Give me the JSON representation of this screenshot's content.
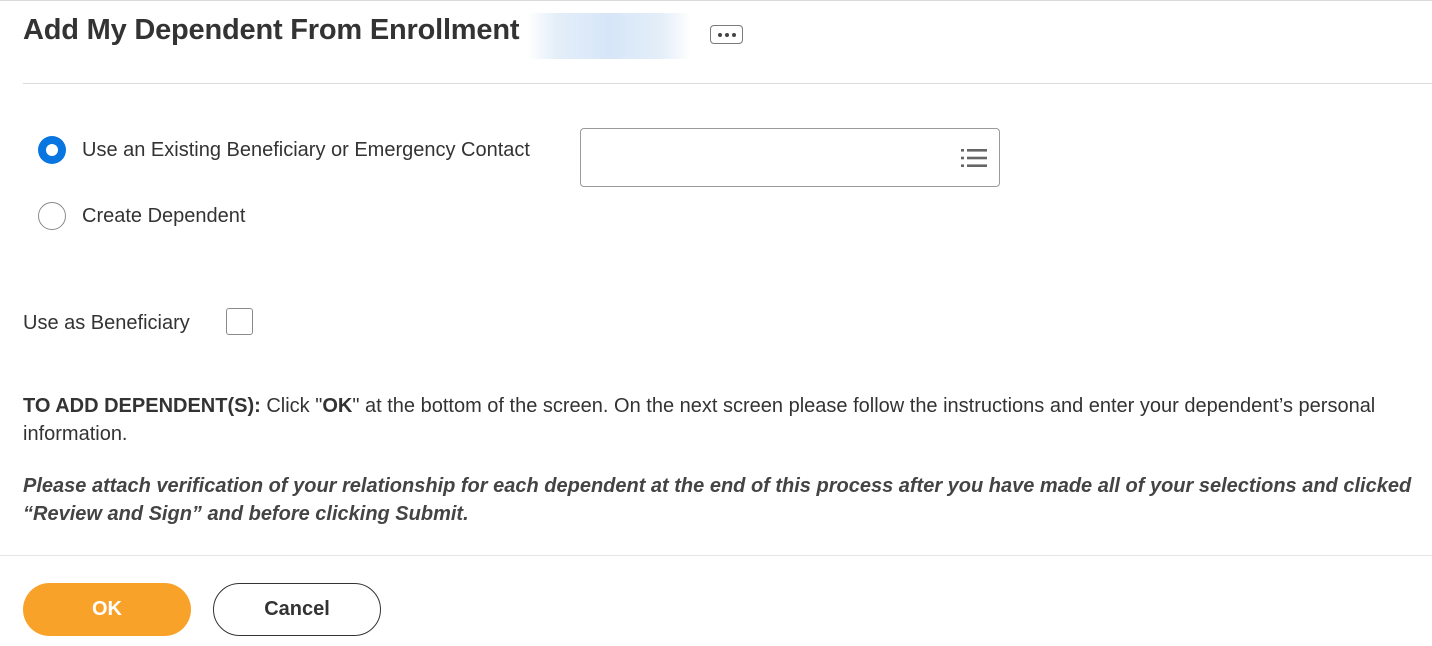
{
  "header": {
    "title": "Add My Dependent From Enrollment"
  },
  "options": {
    "existing_label": "Use an Existing Beneficiary or Emergency Contact",
    "create_label": "Create Dependent",
    "selected": "existing"
  },
  "prompt": {
    "value": "",
    "icon": "list-prompt-icon"
  },
  "beneficiary": {
    "label": "Use as Beneficiary",
    "checked": false
  },
  "instructions": {
    "bold_prefix": "TO ADD DEPENDENT(S):",
    "text_before": " Click \"",
    "ok_word": "OK",
    "text_after": "\" at the bottom of the screen. On the next screen please follow the instructions and enter your dependent’s personal information."
  },
  "note": {
    "text": "Please attach verification of your relationship for each dependent at the end of this process after you have made all of your selections and clicked “Review and Sign” and before clicking Submit."
  },
  "footer": {
    "ok_label": "OK",
    "cancel_label": "Cancel"
  },
  "colors": {
    "accent_blue": "#0875e1",
    "ok_orange": "#f9a22a",
    "text": "#333333"
  }
}
